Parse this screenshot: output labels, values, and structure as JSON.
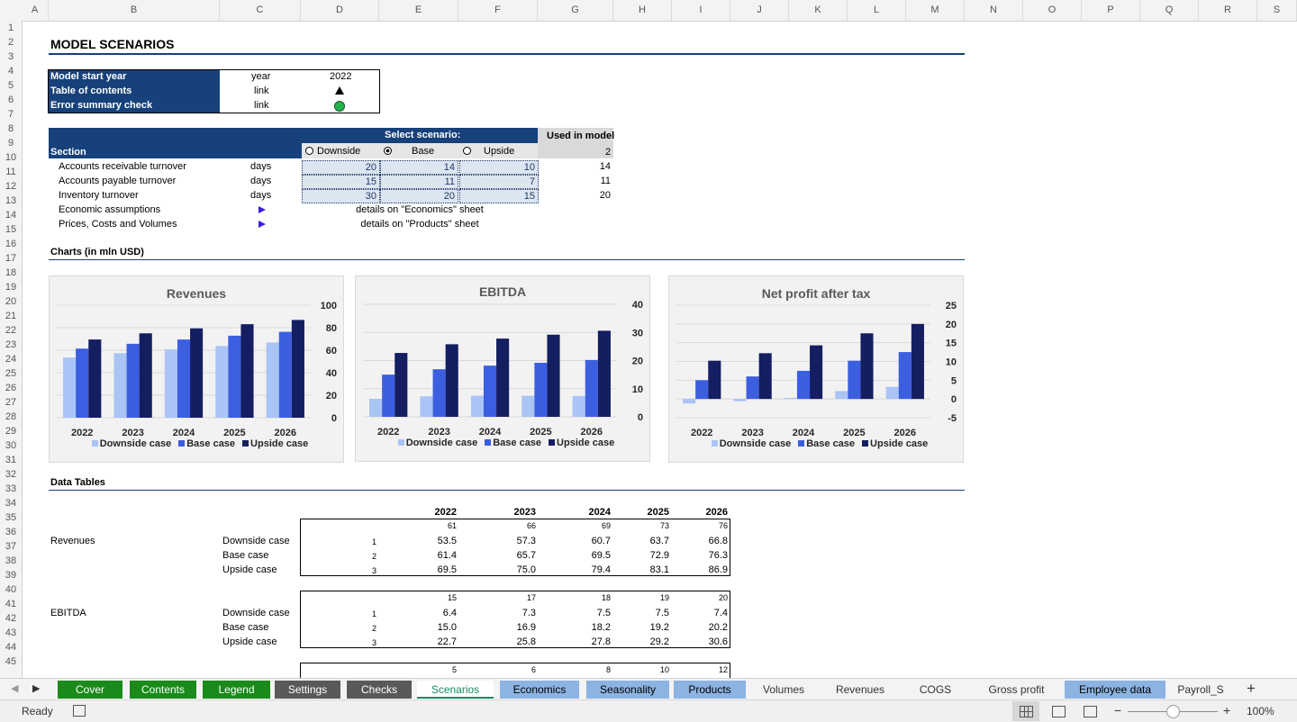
{
  "columns": [
    "A",
    "B",
    "C",
    "D",
    "E",
    "F",
    "G",
    "H",
    "I",
    "J",
    "K",
    "L",
    "M",
    "N",
    "O",
    "P",
    "Q",
    "R",
    "S"
  ],
  "rows": [
    "1",
    "2",
    "3",
    "4",
    "5",
    "6",
    "7",
    "8",
    "9",
    "10",
    "11",
    "12",
    "13",
    "14",
    "15",
    "16",
    "17",
    "18",
    "19",
    "20",
    "21",
    "22",
    "23",
    "24",
    "25",
    "26",
    "27",
    "28",
    "29",
    "30",
    "31",
    "32",
    "33",
    "34",
    "35",
    "36",
    "37",
    "38",
    "39",
    "40",
    "41",
    "42",
    "43",
    "44",
    "45"
  ],
  "title": "MODEL SCENARIOS",
  "info": {
    "start_label": "Model start year",
    "start_unit": "year",
    "start_value": "2022",
    "toc_label": "Table of contents",
    "toc_unit": "link",
    "toc_icon": "triangle-up-icon",
    "err_label": "Error summary check",
    "err_unit": "link",
    "err_color": "#22b14c"
  },
  "scenario": {
    "select_label": "Select scenario:",
    "used_label": "Used in model",
    "section_label": "Section",
    "options": [
      "Downside",
      "Base",
      "Upside"
    ],
    "selected": "Base",
    "used_value": "2",
    "rows": [
      {
        "name": "Accounts receivable turnover",
        "unit": "days",
        "values": [
          "20",
          "14",
          "10"
        ],
        "used": "14"
      },
      {
        "name": "Accounts payable turnover",
        "unit": "days",
        "values": [
          "15",
          "11",
          "7"
        ],
        "used": "11"
      },
      {
        "name": "Inventory turnover",
        "unit": "days",
        "values": [
          "30",
          "20",
          "15"
        ],
        "used": "20"
      }
    ],
    "links": [
      {
        "name": "Economic assumptions",
        "text": "details on \"Economics\" sheet"
      },
      {
        "name": "Prices, Costs and Volumes",
        "text": "details on \"Products\" sheet"
      }
    ]
  },
  "charts_heading": "Charts (in mln USD)",
  "chart_data": [
    {
      "type": "bar",
      "title": "Revenues",
      "categories": [
        "2022",
        "2023",
        "2024",
        "2025",
        "2026"
      ],
      "series": [
        {
          "name": "Downside case",
          "values": [
            53.5,
            57.3,
            60.7,
            63.7,
            66.8
          ]
        },
        {
          "name": "Base case",
          "values": [
            61.4,
            65.7,
            69.5,
            72.9,
            76.3
          ]
        },
        {
          "name": "Upside case",
          "values": [
            69.5,
            75.0,
            79.4,
            83.1,
            86.9
          ]
        }
      ],
      "ylim": [
        0,
        100
      ],
      "yticks": [
        "100",
        "80",
        "60",
        "40",
        "20",
        "0"
      ],
      "grid": true,
      "legend": "bottom"
    },
    {
      "type": "bar",
      "title": "EBITDA",
      "categories": [
        "2022",
        "2023",
        "2024",
        "2025",
        "2026"
      ],
      "series": [
        {
          "name": "Downside case",
          "values": [
            6.4,
            7.3,
            7.5,
            7.5,
            7.4
          ]
        },
        {
          "name": "Base case",
          "values": [
            15.0,
            16.9,
            18.2,
            19.2,
            20.2
          ]
        },
        {
          "name": "Upside case",
          "values": [
            22.7,
            25.8,
            27.8,
            29.2,
            30.6
          ]
        }
      ],
      "ylim": [
        0,
        40
      ],
      "yticks": [
        "40",
        "30",
        "20",
        "10",
        "0"
      ],
      "grid": true,
      "legend": "bottom"
    },
    {
      "type": "bar",
      "title": "Net profit after tax",
      "categories": [
        "2022",
        "2023",
        "2024",
        "2025",
        "2026"
      ],
      "series": [
        {
          "name": "Downside case",
          "values": [
            -1.2,
            -0.6,
            0.3,
            2.1,
            3.2
          ]
        },
        {
          "name": "Base case",
          "values": [
            5.0,
            6.0,
            7.5,
            10.2,
            12.5
          ]
        },
        {
          "name": "Upside case",
          "values": [
            10.2,
            12.2,
            14.3,
            17.5,
            20.0
          ]
        }
      ],
      "ylim": [
        -5,
        25
      ],
      "yticks": [
        "25",
        "20",
        "15",
        "10",
        "5",
        "0",
        "-5"
      ],
      "grid": true,
      "legend": "bottom"
    }
  ],
  "colors": {
    "downside": "#a9c4f5",
    "base": "#3c5ee0",
    "upside": "#141e61",
    "header": "#17417a"
  },
  "data_tables_heading": "Data Tables",
  "years": [
    "2022",
    "2023",
    "2024",
    "2025",
    "2026"
  ],
  "tables": [
    {
      "name": "Revenues",
      "top": [
        "61",
        "66",
        "69",
        "73",
        "76"
      ],
      "rows": [
        {
          "label": "Downside case",
          "idx": "1",
          "vals": [
            "53.5",
            "57.3",
            "60.7",
            "63.7",
            "66.8"
          ]
        },
        {
          "label": "Base case",
          "idx": "2",
          "vals": [
            "61.4",
            "65.7",
            "69.5",
            "72.9",
            "76.3"
          ]
        },
        {
          "label": "Upside case",
          "idx": "3",
          "vals": [
            "69.5",
            "75.0",
            "79.4",
            "83.1",
            "86.9"
          ]
        }
      ]
    },
    {
      "name": "EBITDA",
      "top": [
        "15",
        "17",
        "18",
        "19",
        "20"
      ],
      "rows": [
        {
          "label": "Downside case",
          "idx": "1",
          "vals": [
            "6.4",
            "7.3",
            "7.5",
            "7.5",
            "7.4"
          ]
        },
        {
          "label": "Base case",
          "idx": "2",
          "vals": [
            "15.0",
            "16.9",
            "18.2",
            "19.2",
            "20.2"
          ]
        },
        {
          "label": "Upside case",
          "idx": "3",
          "vals": [
            "22.7",
            "25.8",
            "27.8",
            "29.2",
            "30.6"
          ]
        }
      ]
    },
    {
      "name": "",
      "top": [
        "5",
        "6",
        "8",
        "10",
        "12"
      ],
      "rows": []
    }
  ],
  "tabs": [
    {
      "label": "Cover",
      "bg": "#1a8a1a",
      "fg": "#ffffff"
    },
    {
      "label": "Contents",
      "bg": "#1a8a1a",
      "fg": "#ffffff"
    },
    {
      "label": "Legend",
      "bg": "#1a8a1a",
      "fg": "#ffffff"
    },
    {
      "label": "Settings",
      "bg": "#595959",
      "fg": "#ffffff"
    },
    {
      "label": "Checks",
      "bg": "#595959",
      "fg": "#ffffff"
    },
    {
      "label": "Scenarios",
      "bg": "#ffffff",
      "fg": "#1a8a6a"
    },
    {
      "label": "Economics",
      "bg": "#8db3e2",
      "fg": "#000000"
    },
    {
      "label": "Seasonality",
      "bg": "#8db3e2",
      "fg": "#000000"
    },
    {
      "label": "Products",
      "bg": "#8db3e2",
      "fg": "#000000"
    },
    {
      "label": "Volumes",
      "bg": "#f3f3f3",
      "fg": "#333333"
    },
    {
      "label": "Revenues",
      "bg": "#f3f3f3",
      "fg": "#333333"
    },
    {
      "label": "COGS",
      "bg": "#f3f3f3",
      "fg": "#333333"
    },
    {
      "label": "Gross profit",
      "bg": "#f3f3f3",
      "fg": "#333333"
    },
    {
      "label": "Employee data",
      "bg": "#8db3e2",
      "fg": "#000000"
    },
    {
      "label": "Payroll_S",
      "bg": "#f3f3f3",
      "fg": "#333333"
    }
  ],
  "status": {
    "ready": "Ready",
    "zoom": "100%"
  }
}
